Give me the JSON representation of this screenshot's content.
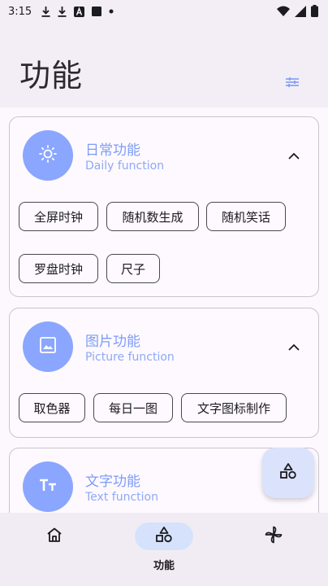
{
  "status_bar": {
    "time": "3:15",
    "icons": [
      "download-icon",
      "download-icon",
      "a-box-icon",
      "square-icon",
      "dot-icon",
      "wifi-icon",
      "signal-icon",
      "battery-icon"
    ]
  },
  "header": {
    "title": "功能",
    "action_icon": "tune-icon"
  },
  "cards": [
    {
      "icon": "sun-icon",
      "title": "日常功能",
      "subtitle": "Daily function",
      "expanded": true,
      "chips": [
        "全屏时钟",
        "随机数生成",
        "随机笑话",
        "罗盘时钟",
        "尺子"
      ]
    },
    {
      "icon": "image-icon",
      "title": "图片功能",
      "subtitle": "Picture function",
      "expanded": true,
      "chips": [
        "取色器",
        "每日一图",
        "文字图标制作"
      ]
    },
    {
      "icon": "text-icon",
      "title": "文字功能",
      "subtitle": "Text function",
      "expanded": false,
      "chips": []
    }
  ],
  "fab": {
    "icon": "shapes-icon"
  },
  "bottom_nav": {
    "items": [
      {
        "icon": "home-icon",
        "label": "",
        "active": false
      },
      {
        "icon": "shapes-icon",
        "label": "功能",
        "active": true
      },
      {
        "icon": "pinwheel-icon",
        "label": "",
        "active": false
      }
    ]
  },
  "colors": {
    "accent": "#8aa6ff",
    "accent_text": "#7e9cf6",
    "fab_bg": "#dbe2fb",
    "nav_active_pill": "#d6e2fb"
  }
}
